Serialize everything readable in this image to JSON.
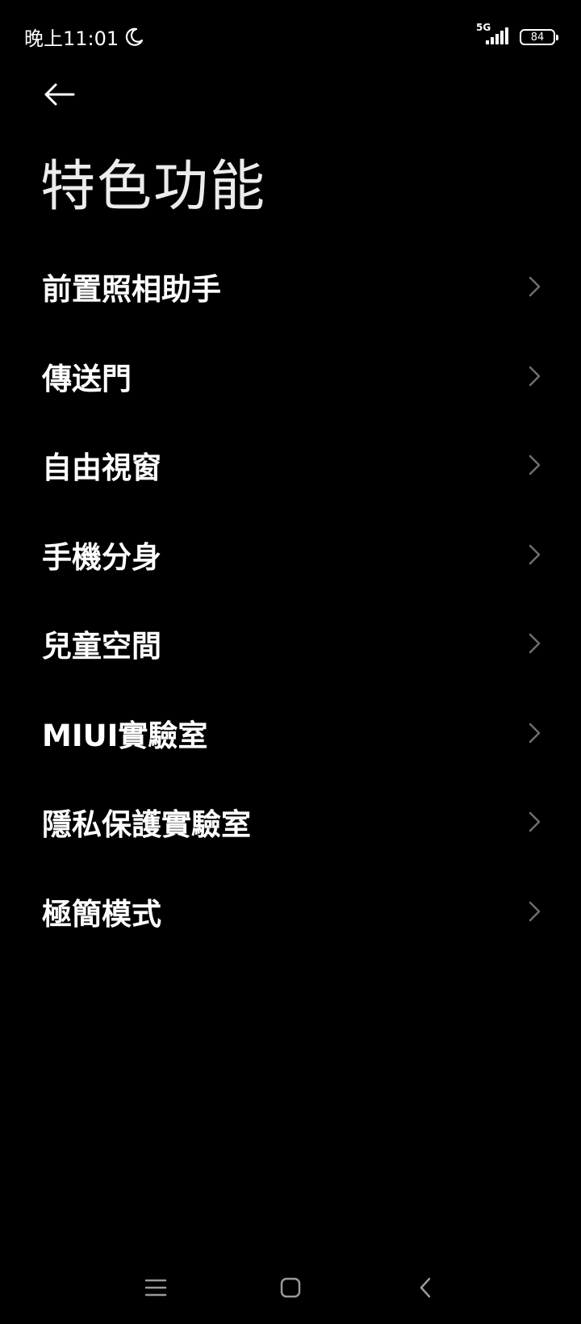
{
  "status_bar": {
    "time": "晚上11:01",
    "network": "5G",
    "battery": "84"
  },
  "page": {
    "title": "特色功能"
  },
  "menu": {
    "items": [
      {
        "label": "前置照相助手"
      },
      {
        "label": "傳送門"
      },
      {
        "label": "自由視窗"
      },
      {
        "label": "手機分身"
      },
      {
        "label": "兒童空間"
      },
      {
        "label": "MIUI實驗室"
      },
      {
        "label": "隱私保護實驗室"
      },
      {
        "label": "極簡模式"
      }
    ]
  },
  "icons": {
    "back": "back-arrow-icon",
    "chevron": "chevron-right-icon",
    "moon": "moon-icon",
    "signal": "signal-icon",
    "battery": "battery-icon",
    "nav_menu": "recent-apps-icon",
    "nav_home": "home-icon",
    "nav_back": "back-icon"
  },
  "colors": {
    "background": "#000000",
    "text": "#ffffff",
    "chevron": "#6e6e6e"
  }
}
